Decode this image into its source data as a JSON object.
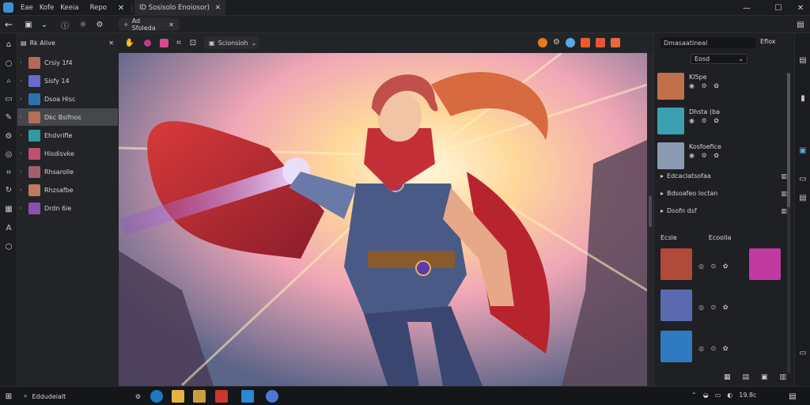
{
  "titlebar": {
    "menu": [
      "Eae",
      "Kofe",
      "Keeia",
      "Repo"
    ],
    "tab_label": "ID Sosisolo Enoiosor)",
    "window_controls": [
      "minimize-icon",
      "maximize-icon",
      "close-icon"
    ]
  },
  "toolbar": {
    "chip_label": "Ad Sfoleda",
    "mode_dropdown": "Scionsioh",
    "accent_colors": [
      "#e6781f",
      "#f05a28",
      "#5aa9e6",
      "#e8543a"
    ]
  },
  "layers": {
    "header": "Rk Alive",
    "items": [
      {
        "label": "Crsiy 1f4",
        "color": "#b36a5a",
        "selected": false
      },
      {
        "label": "Sisfy 14",
        "color": "#6a6ad0",
        "selected": false
      },
      {
        "label": "Dsoa Hisc",
        "color": "#2f6fb0",
        "selected": false
      },
      {
        "label": "Dkc Bsifnos",
        "color": "#b0705a",
        "selected": true
      },
      {
        "label": "Ehdvrifle",
        "color": "#2f9aa0",
        "selected": false
      },
      {
        "label": "Hisdisvke",
        "color": "#c05070",
        "selected": false
      },
      {
        "label": "Rhsarolle",
        "color": "#a06070",
        "selected": false
      },
      {
        "label": "Rhzsafbe",
        "color": "#c07a60",
        "selected": false
      },
      {
        "label": "Drdn 6ie",
        "color": "#8a50b0",
        "selected": false
      }
    ]
  },
  "right": {
    "search_placeholder": "Dmasaatlneal",
    "search_button": "Eflox",
    "filter_value": "Eosd",
    "assets": [
      {
        "title": "Kl5pe",
        "color": "#c0704a"
      },
      {
        "title": "Dhsta (ba",
        "color": "#3aa0b0"
      },
      {
        "title": "Kosfoefice",
        "color": "#8a9ab0"
      }
    ],
    "list_rows": [
      "Edcaclatsofaa",
      "Bdsoafeo loctan",
      "Dsofn dsf"
    ],
    "section_left": "Ecsle",
    "section_right": "Ecoolla",
    "gallery": [
      {
        "color": "#b04a3a"
      },
      {
        "color": "#c03aa0"
      },
      {
        "color": "#5a6ab0"
      },
      {
        "color": "#2f7ac0"
      }
    ]
  },
  "taskbar": {
    "search_text": "Eddudeialt",
    "clock": "19.8c"
  }
}
